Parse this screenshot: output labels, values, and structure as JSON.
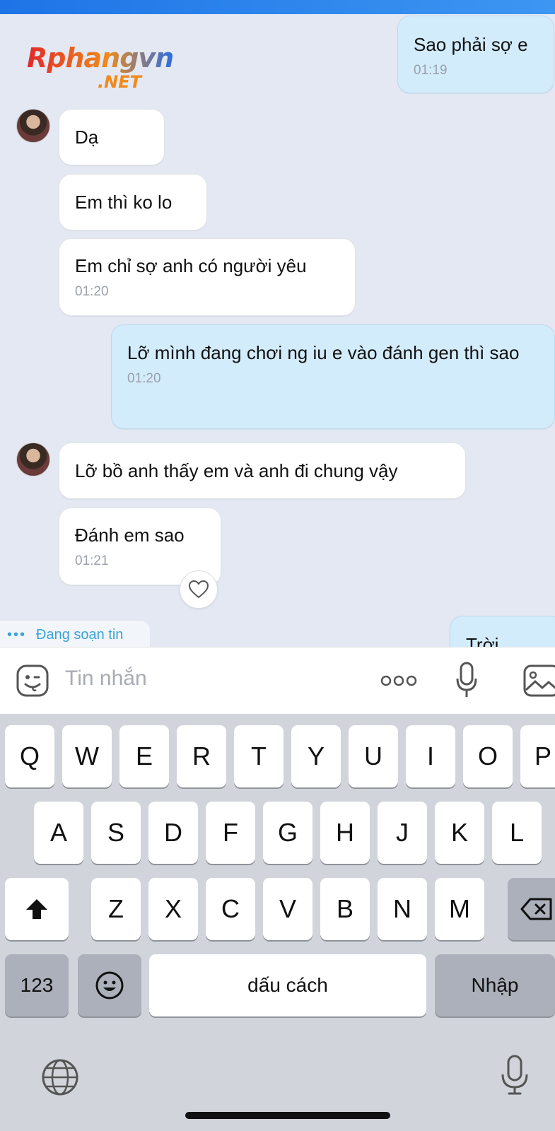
{
  "watermark": {
    "main": "Rphangvn",
    "sub": ".NET"
  },
  "messages": [
    {
      "text": "Sao phải sợ e",
      "time": "01:19"
    },
    {
      "text": "Dạ"
    },
    {
      "text": "Em thì ko lo"
    },
    {
      "text": "Em chỉ sợ anh có người yêu",
      "time": "01:20"
    },
    {
      "text": "Lỡ mình đang chơi ng iu e vào đánh gen thì sao",
      "time": "01:20"
    },
    {
      "text": "Lỡ bồ anh thấy em và anh đi chung vậy"
    },
    {
      "text": "Đánh em sao",
      "time": "01:21"
    },
    {
      "text": "Trời"
    }
  ],
  "typing": {
    "label": "Đang soạn tin",
    "dots": "•••"
  },
  "input": {
    "placeholder": "Tin nhắn",
    "more": "ooo"
  },
  "keyboard": {
    "row1": [
      "Q",
      "W",
      "E",
      "R",
      "T",
      "Y",
      "U",
      "I",
      "O",
      "P"
    ],
    "row2": [
      "A",
      "S",
      "D",
      "F",
      "G",
      "H",
      "J",
      "K",
      "L"
    ],
    "row3": [
      "Z",
      "X",
      "C",
      "V",
      "B",
      "N",
      "M"
    ],
    "numbers": "123",
    "space": "dấu cách",
    "enter": "Nhập"
  },
  "icons": {
    "sticker": "sticker-face-icon",
    "more": "more-options-icon",
    "mic": "microphone-icon",
    "image": "image-icon",
    "heart": "heart-outline-icon",
    "shift": "shift-arrow-icon",
    "delete": "backspace-icon",
    "emoji": "emoji-icon",
    "globe": "globe-icon",
    "dictation": "dictation-mic-icon"
  },
  "colors": {
    "outgoing": "#d3ecfc",
    "incoming": "#ffffff",
    "accent": "#1e74e6"
  }
}
